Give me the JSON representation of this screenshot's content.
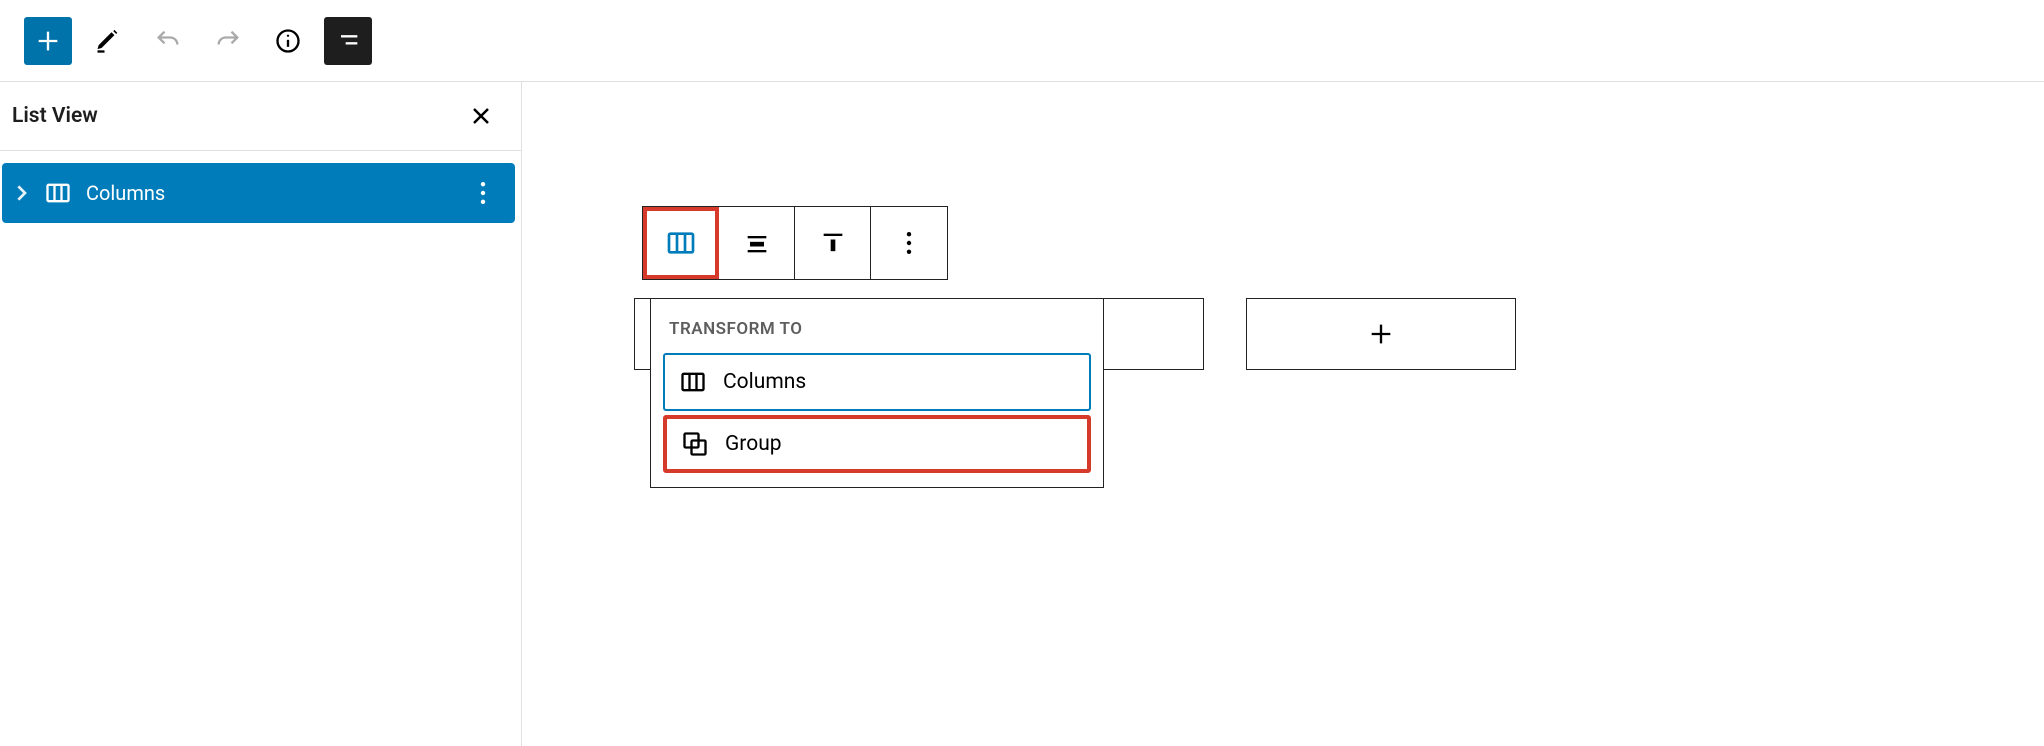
{
  "sidebar": {
    "title": "List View",
    "items": [
      {
        "label": "Columns"
      }
    ]
  },
  "transform": {
    "heading": "TRANSFORM TO",
    "options": {
      "columns": "Columns",
      "group": "Group"
    }
  },
  "colors": {
    "accent": "#007cba",
    "danger_highlight": "#d63a2a",
    "toolbar_dark": "#1e1e1e"
  }
}
